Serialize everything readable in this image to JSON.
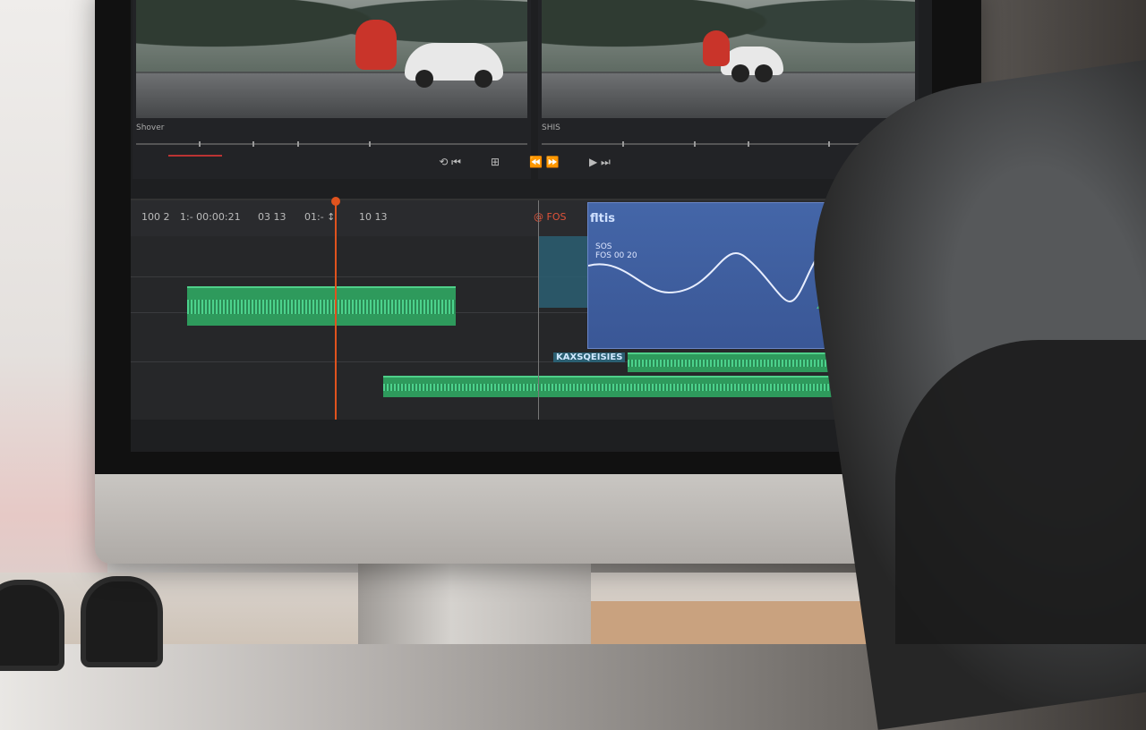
{
  "viewer": {
    "left_label": "Shover",
    "right_label": "SHIS"
  },
  "transport": {
    "items": [
      "⟲ ⏮",
      "⊞",
      "⏪ ⏩",
      "▶ ⏭"
    ]
  },
  "timeline": {
    "timecode_1": "100 2",
    "timecode_2": "1:- 00:00:21",
    "timecode_3": "03 13",
    "timecode_4": "01:- ↕",
    "timecode_5": "10  13",
    "red_label": "@ FOS",
    "fx_title": "fltis",
    "fx_sublabel_1": "SOS",
    "fx_sublabel_2": "FOS 00 20",
    "right_top": "↗ ↗",
    "clip_label": "KAXSQEISIES"
  },
  "colors": {
    "playhead": "#e0531e",
    "audio_clip": "#2e9a5c",
    "fx_panel": "#4466a8"
  }
}
